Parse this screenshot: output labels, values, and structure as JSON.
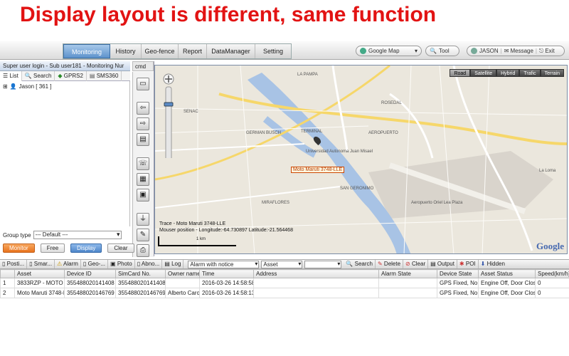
{
  "banner": {
    "text": "Display layout is different, same function",
    "color": "#e21313"
  },
  "nav": {
    "tabs": [
      {
        "label": "Monitoring",
        "active": true
      },
      {
        "label": "History"
      },
      {
        "label": "Geo-fence"
      },
      {
        "label": "Report"
      },
      {
        "label": "DataManager"
      },
      {
        "label": "Setting"
      }
    ]
  },
  "top_controls": {
    "map_select": "Google Map",
    "tool": "Tool",
    "user": "JASON",
    "message": "Message",
    "exit": "Exit"
  },
  "left_panel": {
    "title": "Super user login - Sub user181 - Monitoring Nur",
    "cmd": "cmd",
    "tabs": [
      "List",
      "Search",
      "GPRS2",
      "SMS360"
    ],
    "tree_item": "Jason [ 361 ]",
    "group_label": "Group type",
    "group_value": "--- Default ---",
    "buttons": {
      "monitor": "Monitor",
      "free": "Free",
      "display": "Display",
      "clear": "Clear"
    }
  },
  "map": {
    "types": [
      "Road",
      "Satellite",
      "Hybrid",
      "Trafic",
      "Terrain"
    ],
    "active_type": "Road",
    "vehicle_label": "Moto Maruti 3748-LLE",
    "trace_text": "Trace - Moto Maruti 3748-LLE",
    "mouse_text": "Mouser position - Longitude:-64.730897 Latitude:-21.564468",
    "scale_label": "1 km",
    "provider": "Google",
    "place_labels": [
      "LA PAMPA",
      "SENAC",
      "TERMINAL",
      "GERMAN BUSCH",
      "AEROPUERTO",
      "SAN GERONIMO",
      "MIRAFLORES",
      "Aeropuerto Oriel Lea Plaza",
      "Universidad Autonoma Juan Misael",
      "ROSEDAL",
      "La Loma"
    ]
  },
  "bottom_toolbar": {
    "items": [
      "Posti...",
      "Smar...",
      "Alarm",
      "Geo-...",
      "Photo",
      "Abno...",
      "Log"
    ],
    "alarm_select": "Alarm with notice",
    "asset_select": "Asset",
    "actions": [
      "Search",
      "Delete",
      "Clear",
      "Output",
      "POI",
      "Hidden"
    ]
  },
  "table": {
    "columns": [
      "",
      "Asset",
      "Device ID",
      "SimCard No.",
      "Owner name",
      "Time",
      "Address",
      "Alarm State",
      "Device State",
      "Asset Status",
      "Speed(km/h)"
    ],
    "rows": [
      [
        "1",
        "3833RZP - MOTO",
        "355488020141408",
        "355488020141408",
        "",
        "2016-03-26 14:58:58",
        "",
        "",
        "GPS Fixed, No Lo",
        "Engine Off, Door Close,",
        "0"
      ],
      [
        "2",
        "Moto Maruti 3748-LL",
        "355488020146769",
        "355488020146769",
        "Alberto Caro",
        "2016-03-26 14:58:13",
        "",
        "",
        "GPS Fixed, No Lo",
        "Engine Off, Door Close,",
        "0"
      ]
    ]
  }
}
